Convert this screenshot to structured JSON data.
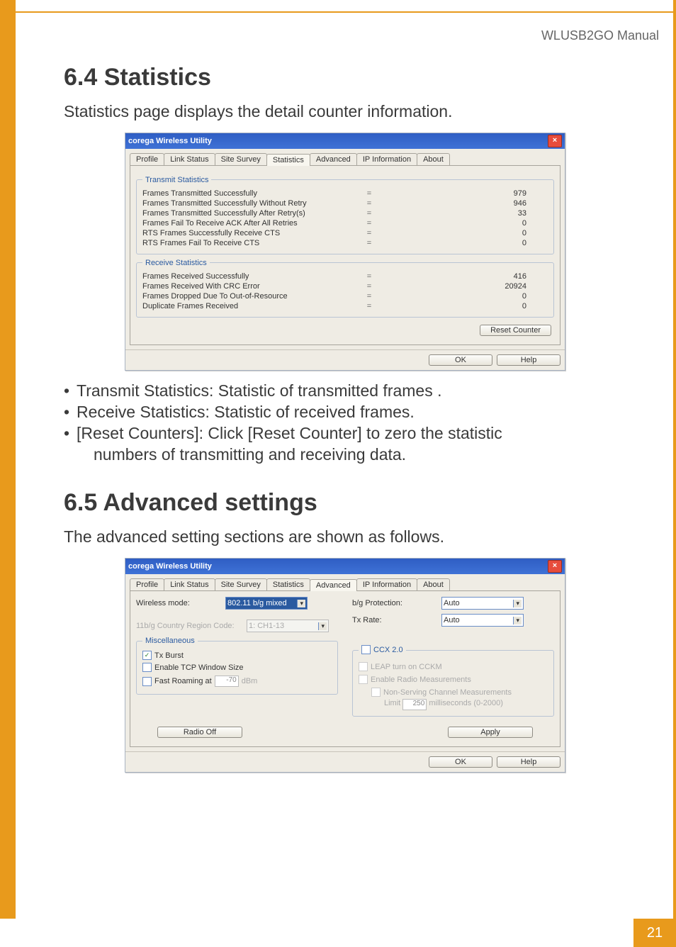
{
  "doc_header": "WLUSB2GO  Manual",
  "page_number": "21",
  "section64": {
    "heading": "6.4 Statistics",
    "intro": "Statistics page displays the detail counter information.",
    "bullet1": "Transmit Statistics: Statistic of transmitted frames .",
    "bullet2": "Receive Statistics: Statistic of received frames.",
    "bullet3a": "[Reset Counters]: Click [Reset Counter] to zero the statistic",
    "bullet3b": "numbers of transmitting and receiving data."
  },
  "section65": {
    "heading": "6.5  Advanced settings",
    "intro": "The advanced setting sections are shown as follows."
  },
  "win1": {
    "title": "corega Wireless Utility",
    "tabs": [
      "Profile",
      "Link Status",
      "Site Survey",
      "Statistics",
      "Advanced",
      "IP Information",
      "About"
    ],
    "active_tab": "Statistics",
    "transmit_legend": "Transmit Statistics",
    "receive_legend": "Receive Statistics",
    "tx_rows": [
      {
        "label": "Frames Transmitted Successfully",
        "value": "979"
      },
      {
        "label": "Frames Transmitted Successfully  Without Retry",
        "value": "946"
      },
      {
        "label": "Frames Transmitted Successfully After Retry(s)",
        "value": "33"
      },
      {
        "label": "Frames Fail To Receive ACK After All Retries",
        "value": "0"
      },
      {
        "label": "RTS Frames Successfully Receive CTS",
        "value": "0"
      },
      {
        "label": "RTS Frames Fail To Receive CTS",
        "value": "0"
      }
    ],
    "rx_rows": [
      {
        "label": "Frames Received Successfully",
        "value": "416"
      },
      {
        "label": "Frames Received  With CRC Error",
        "value": "20924"
      },
      {
        "label": "Frames Dropped Due To Out-of-Resource",
        "value": "0"
      },
      {
        "label": "Duplicate Frames Received",
        "value": "0"
      }
    ],
    "reset_btn": "Reset Counter",
    "ok_btn": "OK",
    "help_btn": "Help"
  },
  "win2": {
    "title": "corega Wireless Utility",
    "tabs": [
      "Profile",
      "Link Status",
      "Site Survey",
      "Statistics",
      "Advanced",
      "IP Information",
      "About"
    ],
    "active_tab": "Advanced",
    "left": {
      "wireless_mode_label": "Wireless mode:",
      "wireless_mode_value": "802.11 b/g mixed",
      "region_label": "11b/g Country Region Code:",
      "region_value": "1: CH1-13",
      "misc_legend": "Miscellaneous",
      "tx_burst": "Tx Burst",
      "tcp_win": "Enable TCP Window Size",
      "fast_roaming": "Fast Roaming at",
      "fast_roaming_val": "-70",
      "fast_roaming_unit": "dBm"
    },
    "right": {
      "bg_prot_label": "b/g Protection:",
      "bg_prot_value": "Auto",
      "tx_rate_label": "Tx Rate:",
      "tx_rate_value": "Auto",
      "ccx_legend": "CCX 2.0",
      "leap": "LEAP turn on CCKM",
      "radio_meas": "Enable Radio Measurements",
      "non_serving": "Non-Serving Channel Measurements",
      "limit_label": "Limit",
      "limit_val": "250",
      "limit_unit": "milliseconds (0-2000)"
    },
    "radio_off_btn": "Radio Off",
    "apply_btn": "Apply",
    "ok_btn": "OK",
    "help_btn": "Help"
  }
}
